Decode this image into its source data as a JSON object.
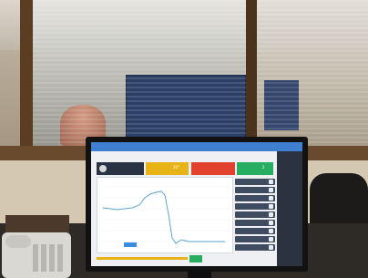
{
  "screen": {
    "header_cards": {
      "yellow_value": "20°",
      "green_value": "2"
    }
  },
  "colors": {
    "accent_blue": "#3e7fd1",
    "card_yellow": "#e7b317",
    "card_red": "#e2412d",
    "card_green": "#27ae60",
    "chart_line": "#5aa6d6",
    "sidebar": "#2b3240"
  }
}
